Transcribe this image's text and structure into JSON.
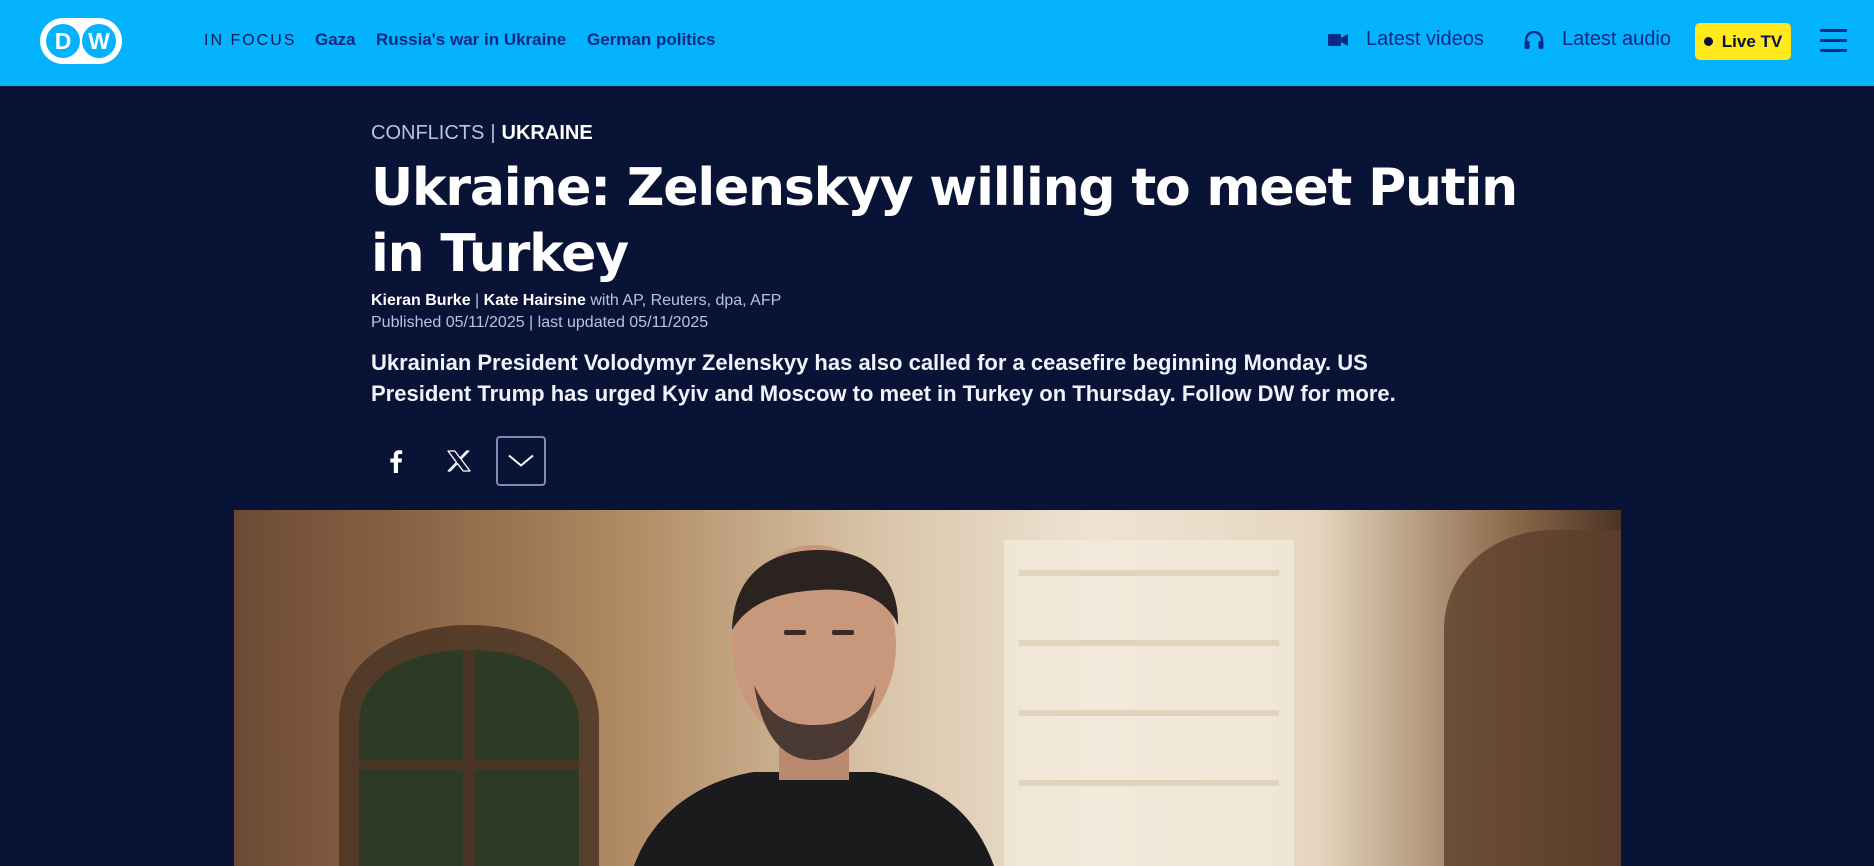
{
  "header": {
    "logo_text": "DW",
    "in_focus_label": "IN FOCUS",
    "focus_links": [
      "Gaza",
      "Russia's war in Ukraine",
      "German politics"
    ],
    "latest_videos": "Latest videos",
    "latest_audio": "Latest audio",
    "live_tv": "Live TV",
    "colors": {
      "bar": "#05b2fc",
      "live_tv": "#ffe81c",
      "link": "#0b2a86"
    }
  },
  "article": {
    "category": "CONFLICTS",
    "category_separator": "|",
    "subcategory": "UKRAINE",
    "headline": "Ukraine: Zelenskyy willing to meet Putin in Turkey",
    "authors": [
      "Kieran Burke",
      "Kate Hairsine"
    ],
    "author_separator": "|",
    "agencies": "with AP, Reuters, dpa, AFP",
    "published": "Published 05/11/2025 | last updated 05/11/2025",
    "teaser": "Ukrainian President Volodymyr Zelenskyy has also called for a ceasefire beginning Monday. US President Trump has urged Kyiv and Moscow to meet in Turkey on Thursday. Follow DW for more."
  },
  "share": {
    "icons": [
      "facebook-icon",
      "x-icon",
      "chevron-down-icon"
    ]
  },
  "theme": {
    "background": "#081336",
    "kicker_color": "#b8c3e4"
  }
}
